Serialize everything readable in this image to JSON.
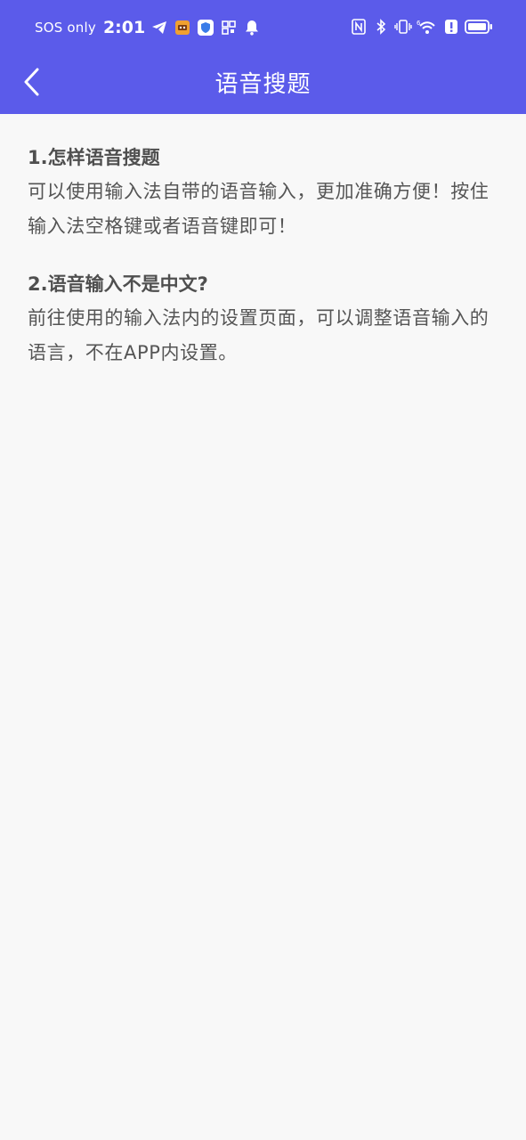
{
  "status_bar": {
    "carrier": "SOS only",
    "time": "2:01",
    "signal_sup": "6"
  },
  "header": {
    "title": "语音搜题"
  },
  "faqs": [
    {
      "question": "1.怎样语音搜题",
      "answer": "可以使用输入法自带的语音输入，更加准确方便！按住输入法空格键或者语音键即可！"
    },
    {
      "question": "2.语音输入不是中文?",
      "answer": "前往使用的输入法内的设置页面，可以调整语音输入的语言，不在APP内设置。"
    }
  ],
  "colors": {
    "header_bg": "#5b5bea",
    "page_bg": "#f8f8f8",
    "text": "#555555"
  }
}
